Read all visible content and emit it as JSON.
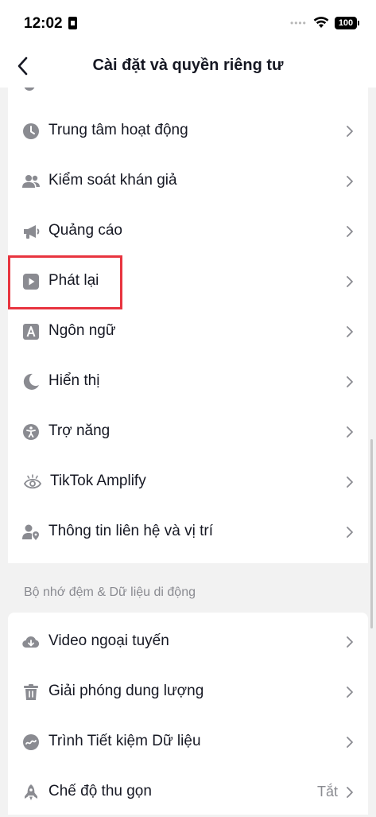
{
  "status_bar": {
    "time": "12:02",
    "battery": "100",
    "icons": [
      "sim-icon",
      "signal-dots-icon",
      "wifi-icon",
      "battery-icon"
    ]
  },
  "header": {
    "title": "Cài đặt và quyền riêng tư",
    "back_icon": "back-arrow-icon"
  },
  "colors": {
    "background": "#f2f2f2",
    "card": "#ffffff",
    "text": "#161823",
    "icon": "#8a8b91",
    "highlight": "#e8343f"
  },
  "main_settings": {
    "items": [
      {
        "label": "Trung tâm hoạt động",
        "icon": "clock-icon"
      },
      {
        "label": "Kiểm soát khán giả",
        "icon": "people-icon"
      },
      {
        "label": "Quảng cáo",
        "icon": "megaphone-icon"
      },
      {
        "label": "Phát lại",
        "icon": "play-icon"
      },
      {
        "label": "Ngôn ngữ",
        "icon": "language-a-icon"
      },
      {
        "label": "Hiển thị",
        "icon": "moon-icon"
      },
      {
        "label": "Trợ năng",
        "icon": "accessibility-icon"
      },
      {
        "label": "TikTok Amplify",
        "icon": "eye-icon"
      },
      {
        "label": "Thông tin liên hệ và vị trí",
        "icon": "contact-location-icon"
      }
    ]
  },
  "cache_section": {
    "header": "Bộ nhớ đệm & Dữ liệu di động",
    "items": [
      {
        "label": "Video ngoại tuyến",
        "icon": "cloud-download-icon"
      },
      {
        "label": "Giải phóng dung lượng",
        "icon": "trash-icon"
      },
      {
        "label": "Trình Tiết kiệm Dữ liệu",
        "icon": "data-saver-icon"
      },
      {
        "label": "Chế độ thu gọn",
        "icon": "rocket-icon",
        "value": "Tắt"
      }
    ]
  }
}
